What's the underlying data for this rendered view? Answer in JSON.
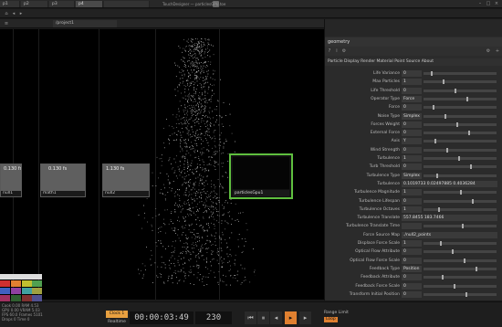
{
  "tabs": [
    {
      "label": "p1"
    },
    {
      "label": "p2"
    },
    {
      "label": "p3"
    },
    {
      "label": "p4"
    }
  ],
  "window_title": "TouchDesigner — particlesGPU.toe",
  "path_bar": "/project1",
  "nodes": [
    {
      "label": "null1",
      "body": "0.130 fs"
    },
    {
      "label": "math1",
      "body": "0.130 fs"
    },
    {
      "label": "null2",
      "body": "1.130 fs"
    }
  ],
  "top_node_label": "particlesGpu1",
  "params": {
    "title": "geometry",
    "tabs": "Particle  Display  Render  Material  Point Source  About",
    "rows": [
      {
        "label": "Life Variance",
        "value": "0"
      },
      {
        "label": "Max Particles",
        "value": "1"
      },
      {
        "label": "Life Threshold",
        "value": "0"
      },
      {
        "label": "Operator Type",
        "value": "Force"
      },
      {
        "label": "Force",
        "value": "0"
      },
      {
        "label": "Noise Type",
        "value": "Simplex"
      },
      {
        "label": "Forces Weight",
        "value": "0"
      },
      {
        "label": "External Force",
        "value": "0"
      },
      {
        "label": "Axis",
        "value": "Y"
      },
      {
        "label": "Wind Strength",
        "value": "0"
      },
      {
        "label": "Turbulence",
        "value": "1"
      },
      {
        "label": "Turb Threshold",
        "value": "0"
      },
      {
        "label": "Turbulence Type",
        "value": "Simplex"
      },
      {
        "label": "Turbulence",
        "value": "0.1019733   0.02497885   0.4036284"
      },
      {
        "label": "Turbulence Magnitude",
        "value": "1"
      },
      {
        "label": "Turbulence Lifespan",
        "value": "0"
      },
      {
        "label": "Turbulence Octaves",
        "value": "1"
      },
      {
        "label": "Turbulence Translate",
        "value": "557.8455   183.7466"
      },
      {
        "label": "Turbulence Translate Time",
        "value": ""
      },
      {
        "label": "Force Source Map",
        "value": "./null2_points"
      },
      {
        "label": "Displace Force Scale",
        "value": "1"
      },
      {
        "label": "Optical Flow Attribute",
        "value": "0"
      },
      {
        "label": "Optical Flow Force Scale",
        "value": "0"
      },
      {
        "label": "Feedback Type",
        "value": "Position"
      },
      {
        "label": "Feedback Attribute",
        "value": "0"
      },
      {
        "label": "Feedback Force Scale",
        "value": "0"
      },
      {
        "label": "Transform Initial Position",
        "value": "0"
      }
    ]
  },
  "stats": {
    "line1": "Cook  0.00   RAM  4.53",
    "line2": "GPU   0.00   VRAM 5.03",
    "line3": "FPS   60.0   Frames 5101",
    "line4": "Drops 0      Time  0"
  },
  "transport": {
    "label_top": "Clock 1",
    "label_bot": "Realtime",
    "timecode": "00:00:03:49",
    "frame": "230",
    "range_label": "Range Limit",
    "range_value": "Loop"
  },
  "colors": {
    "accent": "#e8a040",
    "node_selected": "#5fbf3f",
    "panel_bg": "#2b2b2b"
  }
}
